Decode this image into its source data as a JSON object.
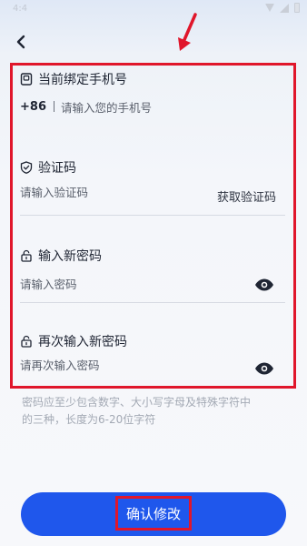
{
  "status_bar": {
    "time": "4:4"
  },
  "nav": {
    "back_icon": "chevron-left-icon"
  },
  "form": {
    "phone": {
      "title": "当前绑定手机号",
      "icon": "phone-icon",
      "prefix": "+86",
      "placeholder": "请输入您的手机号"
    },
    "code": {
      "title": "验证码",
      "icon": "shield-icon",
      "placeholder": "请输入验证码",
      "get_code_label": "获取验证码"
    },
    "new_password": {
      "title": "输入新密码",
      "icon": "lock-icon",
      "placeholder": "请输入密码"
    },
    "confirm_password": {
      "title": "再次输入新密码",
      "icon": "lock-icon",
      "placeholder": "请再次输入密码"
    }
  },
  "hint": {
    "line1": "密码应至少包含数字、大小写字母及特殊字符中",
    "line2": "的三种，长度为6-20位字符"
  },
  "confirm_button": {
    "label": "确认修改"
  },
  "colors": {
    "primary": "#1f57ec",
    "annotation": "#e0162b",
    "hint_text": "#a3a9b4"
  }
}
